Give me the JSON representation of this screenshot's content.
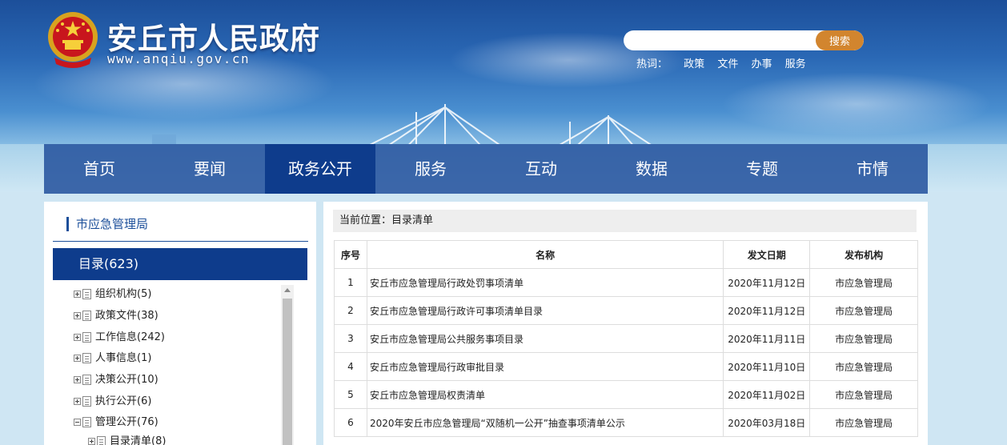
{
  "header": {
    "site_title": "安丘市人民政府",
    "site_url": "www.anqiu.gov.cn",
    "search": {
      "placeholder": "",
      "button_label": "搜索"
    },
    "hotwords": {
      "label": "热词：",
      "items": [
        "政策",
        "文件",
        "办事",
        "服务"
      ]
    }
  },
  "nav": {
    "items": [
      "首页",
      "要闻",
      "政务公开",
      "服务",
      "互动",
      "数据",
      "专题",
      "市情"
    ],
    "active": "政务公开"
  },
  "sidebar": {
    "title": "市应急管理局",
    "catalog_head": "目录(623)",
    "tree": [
      {
        "label": "组织机构(5)",
        "state": "collapsed"
      },
      {
        "label": "政策文件(38)",
        "state": "collapsed"
      },
      {
        "label": "工作信息(242)",
        "state": "collapsed"
      },
      {
        "label": "人事信息(1)",
        "state": "collapsed"
      },
      {
        "label": "决策公开(10)",
        "state": "collapsed"
      },
      {
        "label": "执行公开(6)",
        "state": "collapsed"
      },
      {
        "label": "管理公开(76)",
        "state": "expanded"
      },
      {
        "label": "目录清单(8)",
        "state": "collapsed",
        "child": true
      }
    ]
  },
  "main": {
    "breadcrumb": "当前位置：目录清单",
    "table": {
      "headers": [
        "序号",
        "名称",
        "发文日期",
        "发布机构"
      ],
      "rows": [
        [
          "1",
          "安丘市应急管理局行政处罚事项清单",
          "2020年11月12日",
          "市应急管理局"
        ],
        [
          "2",
          "安丘市应急管理局行政许可事项清单目录",
          "2020年11月12日",
          "市应急管理局"
        ],
        [
          "3",
          "安丘市应急管理局公共服务事项目录",
          "2020年11月11日",
          "市应急管理局"
        ],
        [
          "4",
          "安丘市应急管理局行政审批目录",
          "2020年11月10日",
          "市应急管理局"
        ],
        [
          "5",
          "安丘市应急管理局权责清单",
          "2020年11月02日",
          "市应急管理局"
        ],
        [
          "6",
          "2020年安丘市应急管理局“双随机一公开”抽查事项清单公示",
          "2020年03月18日",
          "市应急管理局"
        ]
      ]
    }
  },
  "colors": {
    "nav_bg": "#27549e",
    "nav_active": "#0e3c8c",
    "search_button": "#d2852e",
    "sidebar_accent": "#1c4f9a"
  }
}
